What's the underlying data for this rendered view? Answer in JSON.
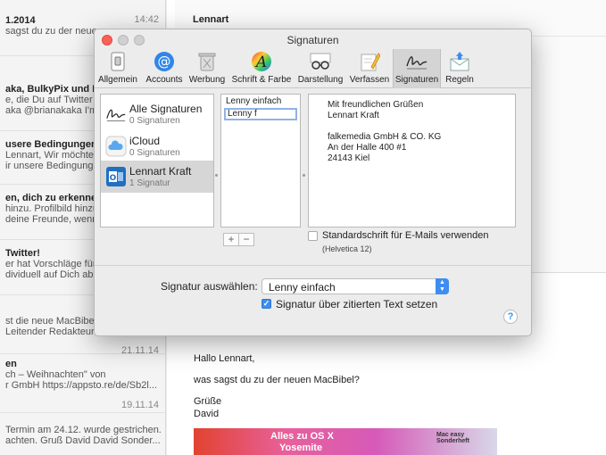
{
  "mail_list": {
    "items": [
      {
        "title": "1.2014",
        "snippet": "sagst du zu der neuen",
        "date": "14:42"
      },
      {
        "title": "aka, BulkyPix und Mi",
        "snippet": "e, die Du auf Twitter ki",
        "snippet2": "aka @brianakaka I'm t"
      },
      {
        "title": "usere Bedingungen un",
        "snippet": "Lennart, Wir möchten di",
        "snippet2": "ir unsere Bedingungen"
      },
      {
        "title": "en, dich zu erkennen",
        "snippet": "hinzu. Profilbild hinzuf",
        "snippet2": "deine Freunde, wenn"
      },
      {
        "title": "Twitter!",
        "snippet": "er hat Vorschläge für",
        "snippet2": "dividuell auf Dich abg"
      },
      {
        "title": "",
        "snippet": "st die neue MacBibel",
        "snippet2": "Leitender Redakteur"
      },
      {
        "title": "",
        "date": "21.11.14"
      },
      {
        "title": "en",
        "snippet": "ch – Weihnachten\" von",
        "snippet2": "r GmbH https://appsto.re/de/Sb2l..."
      },
      {
        "title": "",
        "date": "19.11.14"
      },
      {
        "title": "",
        "snippet": "Termin am 24.12. wurde gestrichen.",
        "snippet2": "achten. Gruß David David Sonder..."
      }
    ]
  },
  "mail_view": {
    "from": "Lennart",
    "greeting": "Hallo Lennart,",
    "body": "was sagst du zu der neuen MacBibel?",
    "sign1": "Grüße",
    "sign2": "David",
    "ad_line1": "Alles zu OS X",
    "ad_line2": "Yosemite",
    "ad_badge": "Mac easy Sonderheft"
  },
  "window": {
    "title": "Signaturen"
  },
  "toolbar": {
    "items": [
      {
        "label": "Allgemein",
        "icon": "switch-icon"
      },
      {
        "label": "Accounts",
        "icon": "at-icon"
      },
      {
        "label": "Werbung",
        "icon": "trash-icon"
      },
      {
        "label": "Schrift & Farbe",
        "icon": "font-icon"
      },
      {
        "label": "Darstellung",
        "icon": "glasses-icon"
      },
      {
        "label": "Verfassen",
        "icon": "pencil-icon"
      },
      {
        "label": "Signaturen",
        "icon": "signature-icon"
      },
      {
        "label": "Regeln",
        "icon": "rules-icon"
      }
    ],
    "active": "Signaturen"
  },
  "accounts": [
    {
      "name": "Alle Signaturen",
      "count": "0 Signaturen",
      "icon": "signature-icon"
    },
    {
      "name": "iCloud",
      "count": "0 Signaturen",
      "icon": "cloud-icon"
    },
    {
      "name": "Lennart Kraft",
      "count": "1 Signatur",
      "icon": "outlook-icon",
      "selected": true
    }
  ],
  "signatures": {
    "items": [
      "Lenny einfach"
    ],
    "editing_value": "Lenny f",
    "add_label": "+",
    "remove_label": "−"
  },
  "preview": {
    "lines": [
      "Mit freundlichen Grüßen",
      "Lennart Kraft",
      "",
      "falkemedia GmbH & CO. KG",
      "An der Halle 400 #1",
      "24143 Kiel"
    ]
  },
  "options": {
    "default_font_label": "Standardschrift für E-Mails verwenden",
    "default_font_checked": false,
    "font_hint": "(Helvetica 12)",
    "choose_label": "Signatur auswählen:",
    "choose_value": "Lenny einfach",
    "quote_label": "Signatur über zitierten Text setzen",
    "quote_checked": true,
    "help_label": "?"
  },
  "colors": {
    "accent": "#3d8ef0",
    "close": "#fc5f57"
  }
}
